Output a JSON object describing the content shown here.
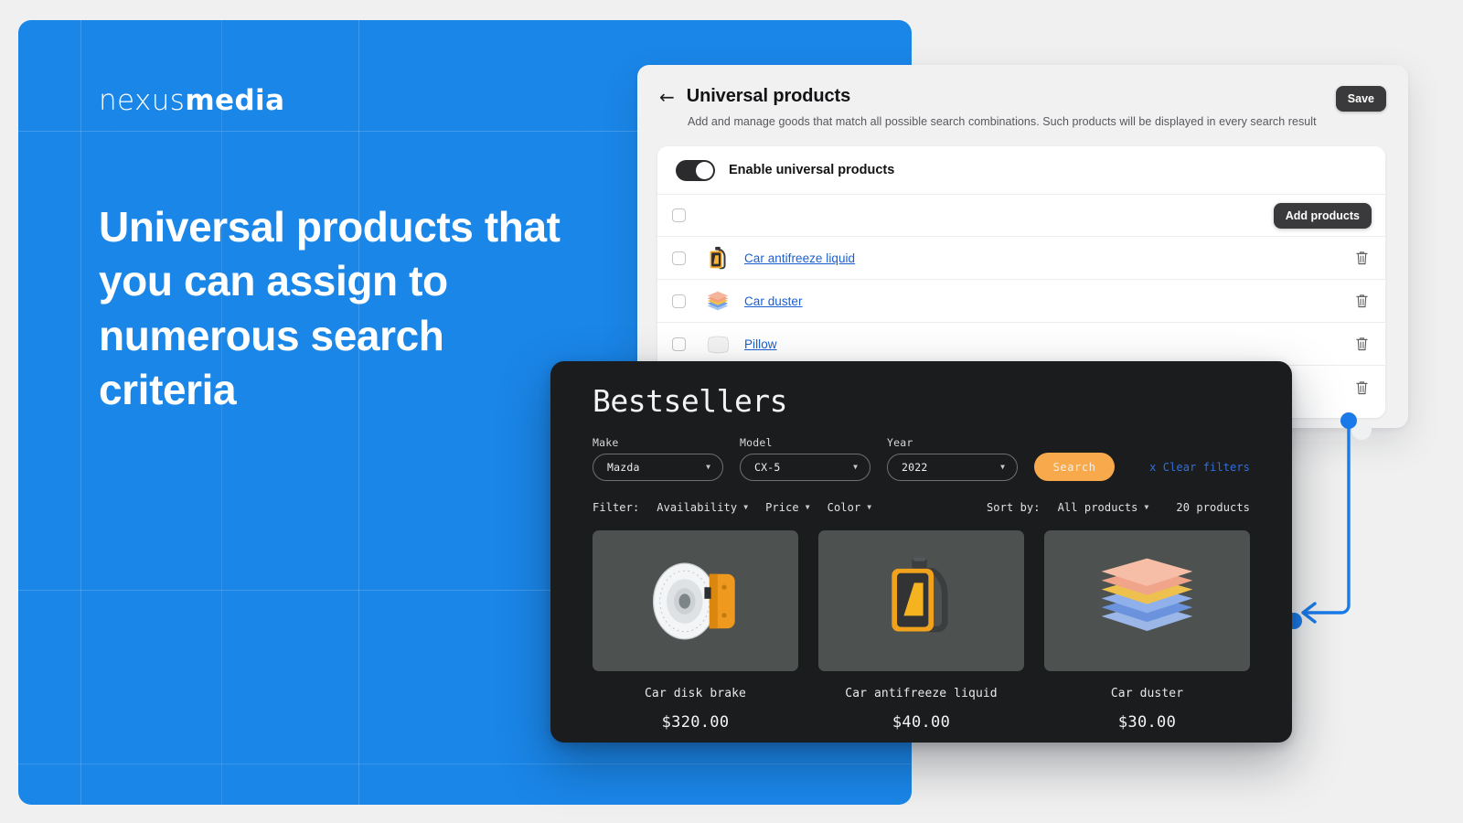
{
  "hero": {
    "logo_thin": "nexus",
    "logo_bold": "media",
    "heading": "Universal products that you can assign to numerous search criteria",
    "brand_color": "#1a86e8"
  },
  "settings_panel": {
    "back_icon": "back-arrow-icon",
    "title": "Universal products",
    "subtitle": "Add and manage goods that match all possible search combinations. Such products will be displayed in every search result",
    "save_label": "Save",
    "toggle": {
      "label": "Enable universal products",
      "state": "on"
    },
    "add_products_label": "Add products",
    "items": [
      {
        "name": "Car antifreeze liquid",
        "thumb": "antifreeze-bottle-icon"
      },
      {
        "name": "Car duster",
        "thumb": "folded-cloths-icon"
      },
      {
        "name": "Pillow",
        "thumb": "pillow-icon"
      }
    ]
  },
  "bestsellers": {
    "title": "Bestsellers",
    "selects": [
      {
        "label": "Make",
        "value": "Mazda"
      },
      {
        "label": "Model",
        "value": "CX-5"
      },
      {
        "label": "Year",
        "value": "2022"
      }
    ],
    "search_label": "Search",
    "search_color": "#f8a94c",
    "clear_filters_label": "x Clear filters",
    "clear_filters_color": "#2f6fe0",
    "filter_label": "Filter:",
    "filters": [
      "Availability",
      "Price",
      "Color"
    ],
    "sort_label": "Sort by:",
    "sort_value": "All products",
    "count_label": "20 products",
    "products": [
      {
        "name": "Car disk brake",
        "price": "$320.00",
        "image": "brake-disc-image"
      },
      {
        "name": "Car antifreeze liquid",
        "price": "$40.00",
        "image": "antifreeze-bottle-image"
      },
      {
        "name": "Car duster",
        "price": "$30.00",
        "image": "folded-cloths-image"
      }
    ]
  },
  "connector": {
    "color": "#1a7ae8",
    "description": "arrow-connector"
  }
}
